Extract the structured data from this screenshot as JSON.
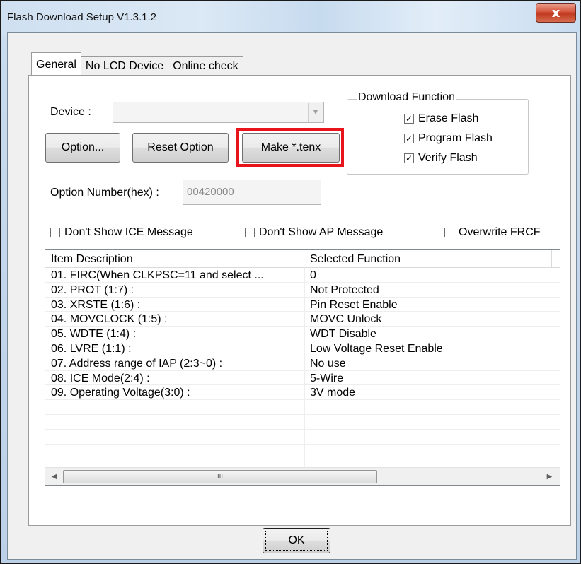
{
  "window": {
    "title": "Flash Download Setup V1.3.1.2",
    "close_label": "x"
  },
  "tabs": [
    {
      "label": "General",
      "active": true
    },
    {
      "label": "No LCD Device",
      "active": false
    },
    {
      "label": "Online check",
      "active": false
    }
  ],
  "device": {
    "label": "Device :",
    "value": "",
    "arrow": "▼"
  },
  "buttons": {
    "option": "Option...",
    "reset_option": "Reset Option",
    "make_tenx": "Make *.tenx",
    "ok": "OK"
  },
  "download_function": {
    "title": "Download Function",
    "items": [
      {
        "label": "Erase Flash",
        "checked": true,
        "mark": "✓"
      },
      {
        "label": "Program Flash",
        "checked": true,
        "mark": "✓"
      },
      {
        "label": "Verify Flash",
        "checked": true,
        "mark": "✓"
      }
    ]
  },
  "option_number": {
    "label": "Option Number(hex) :",
    "value": "00420000"
  },
  "flags": [
    {
      "label": "Don't Show ICE Message",
      "checked": false
    },
    {
      "label": "Don't Show AP Message",
      "checked": false
    },
    {
      "label": "Overwrite FRCF",
      "checked": false
    }
  ],
  "table": {
    "columns": [
      "Item Description",
      "Selected Function"
    ],
    "rows": [
      [
        "01. FIRC(When CLKPSC=11 and select ...",
        "0"
      ],
      [
        "02. PROT (1:7) :",
        "Not Protected"
      ],
      [
        "03. XRSTE (1:6) :",
        "Pin Reset Enable"
      ],
      [
        "04. MOVCLOCK (1:5) :",
        "MOVC Unlock"
      ],
      [
        "05. WDTE (1:4) :",
        "WDT Disable"
      ],
      [
        "06. LVRE (1:1) :",
        "Low Voltage Reset Enable"
      ],
      [
        "07. Address range of IAP (2:3~0)  :",
        "No use"
      ],
      [
        "08. ICE Mode(2:4) :",
        "5-Wire"
      ],
      [
        "09. Operating Voltage(3:0) :",
        "3V mode"
      ]
    ],
    "scroll": {
      "left_arrow": "◀",
      "right_arrow": "▶",
      "thumb_grip": "III"
    }
  }
}
